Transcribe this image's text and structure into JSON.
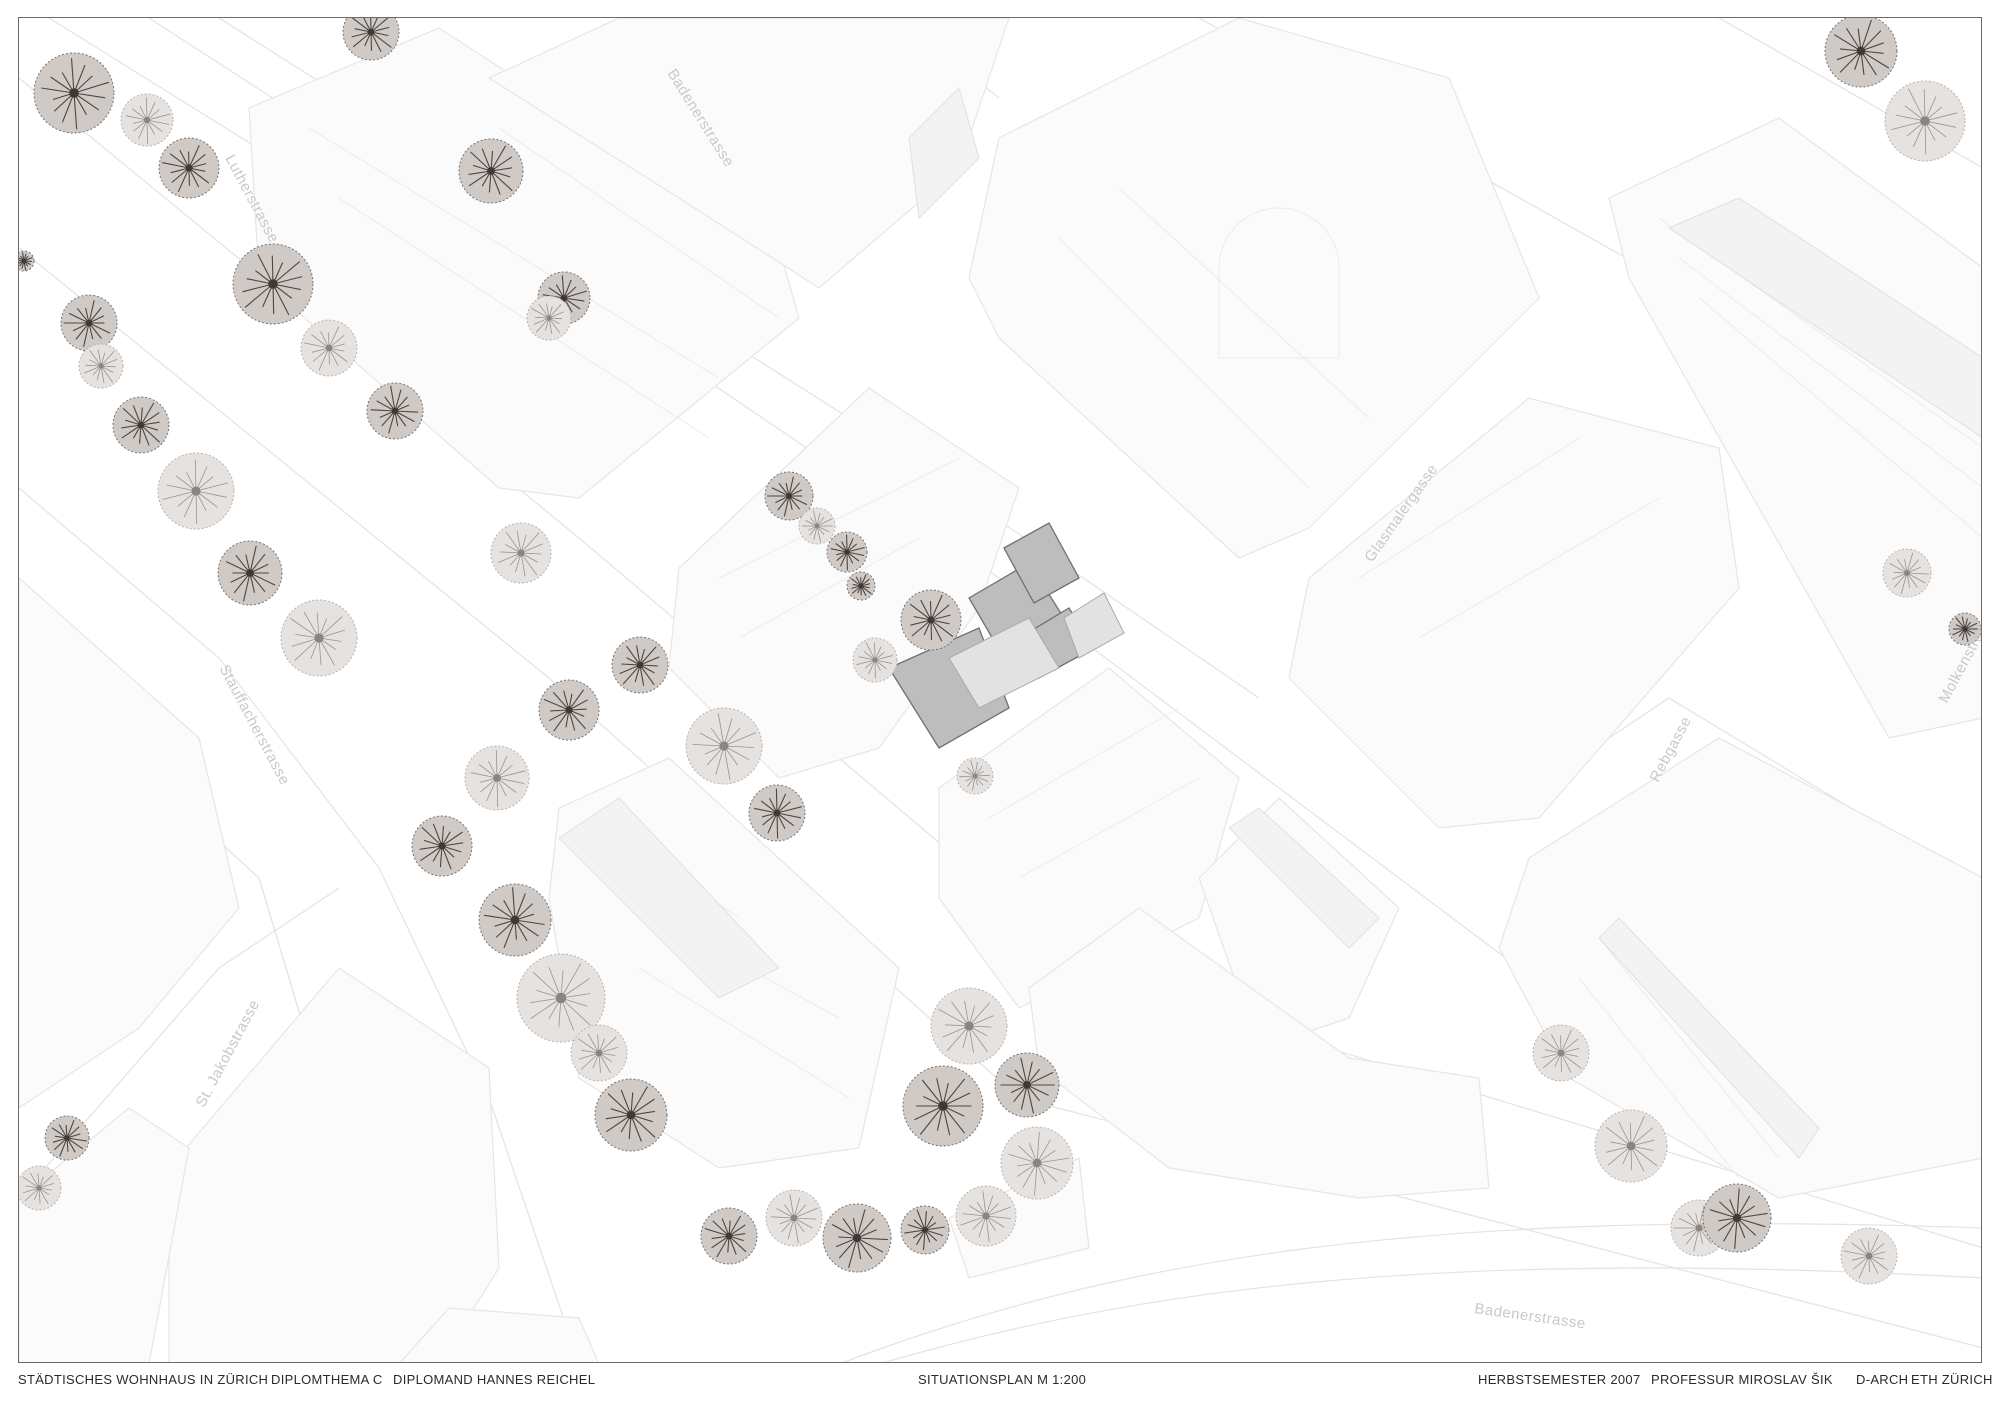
{
  "footer": {
    "project": "STÄDTISCHES WOHNHAUS IN ZÜRICH",
    "theme": "DIPLOMTHEMA C",
    "student": "DIPLOMAND HANNES REICHEL",
    "drawing": "SITUATIONSPLAN  M 1:200",
    "semester": "HERBSTSEMESTER 2007",
    "professor": "PROFESSUR MIROSLAV ŠIK",
    "department": "D-ARCH",
    "school": "ETH ZÜRICH"
  },
  "streets": {
    "s1": "Badenerstrasse",
    "s2": "Lutherstrasse",
    "s3": "Stauffacherstrasse",
    "s4": "St. Jakobstrasse",
    "s5": "Glasmalergasse",
    "s6": "Molkenstrasse",
    "s7": "Rebgasse",
    "s8": "Badenerstrasse"
  },
  "colors": {
    "frame": "#6a6a6a",
    "street_label": "#c9c9c9",
    "building_outline": "#d6d6d6",
    "building_fill": "#f6f6f6",
    "project_building": "#b5b5b5",
    "tree": "#5a5450"
  }
}
